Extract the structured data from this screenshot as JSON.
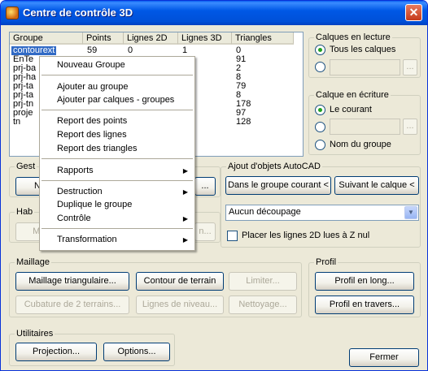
{
  "window": {
    "title": "Centre de contrôle 3D",
    "close_glyph": "✕"
  },
  "list": {
    "columns": [
      "Groupe",
      "Points",
      "Lignes 2D",
      "Lignes 3D",
      "Triangles"
    ],
    "rows": [
      {
        "name": "contourext",
        "points": "59",
        "l2d": "0",
        "l3d": "1",
        "tri": "0",
        "selected": true
      },
      {
        "name": "EnTe",
        "tri": "91"
      },
      {
        "name": "prj-ba",
        "tri": "2"
      },
      {
        "name": "prj-ha",
        "tri": "8"
      },
      {
        "name": "prj-ta",
        "tri": "79"
      },
      {
        "name": "prj-ta",
        "tri": "8"
      },
      {
        "name": "prj-tn",
        "tri": "178"
      },
      {
        "name": "proje",
        "tri": "97"
      },
      {
        "name": "tn",
        "tri": "128"
      }
    ]
  },
  "menu": {
    "items": [
      {
        "label": "Nouveau Groupe",
        "submenu": false
      },
      {
        "label": "Ajouter au groupe",
        "submenu": false
      },
      {
        "label": "Ajouter par calques - groupes",
        "submenu": false
      },
      {
        "label": "Report des points",
        "submenu": false
      },
      {
        "label": "Report des lignes",
        "submenu": false
      },
      {
        "label": "Report des triangles",
        "submenu": false
      },
      {
        "label": "Rapports",
        "submenu": true
      },
      {
        "label": "Destruction",
        "submenu": true
      },
      {
        "label": "Duplique le groupe",
        "submenu": false
      },
      {
        "label": "Contrôle",
        "submenu": true
      },
      {
        "label": "Transformation",
        "submenu": true
      }
    ],
    "arrow_glyph": "▶"
  },
  "calques_lecture": {
    "title": "Calques en lecture",
    "opt_all": "Tous les calques",
    "browse": "..."
  },
  "calque_ecriture": {
    "title": "Calque en écriture",
    "opt_current": "Le courant",
    "opt_group": "Nom du groupe",
    "browse": "..."
  },
  "gestion": {
    "title": "Gest",
    "btn_left": "No",
    "btn_right": "..."
  },
  "habillage": {
    "title": "Hab",
    "btn_left": "Mai",
    "btn_right": "n..."
  },
  "ajout": {
    "title": "Ajout d'objets AutoCAD",
    "btn_group": "Dans le groupe courant <",
    "btn_layer": "Suivant le calque <",
    "combo_value": "Aucun découpage",
    "combo_arrow": "▼",
    "checkbox_label": "Placer les lignes 2D lues à Z nul"
  },
  "maillage": {
    "title": "Maillage",
    "buttons": [
      "Maillage triangulaire...",
      "Contour de terrain",
      "Limiter...",
      "Cubature de 2 terrains...",
      "Lignes de niveau...",
      "Nettoyage..."
    ]
  },
  "profil": {
    "title": "Profil",
    "btn_long": "Profil en long...",
    "btn_travers": "Profil en travers..."
  },
  "utilitaires": {
    "title": "Utilitaires",
    "btn_projection": "Projection...",
    "btn_options": "Options..."
  },
  "footer": {
    "close": "Fermer"
  }
}
